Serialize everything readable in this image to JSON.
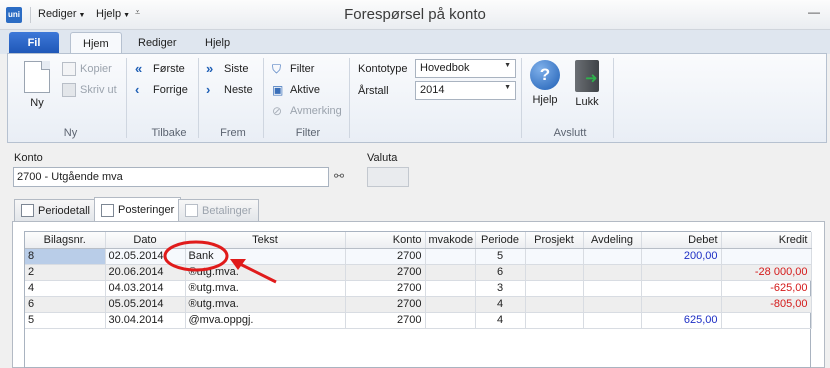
{
  "titlebar": {
    "app_icon_text": "uni",
    "menu_rediger": "Rediger",
    "menu_hjelp": "Hjelp",
    "title": "Forespørsel på konto"
  },
  "ribbon_tabs": {
    "file": "Fil",
    "tabs": [
      "Hjem",
      "Rediger",
      "Hjelp"
    ]
  },
  "ribbon": {
    "ny": {
      "new_label": "Ny",
      "kopier": "Kopier",
      "skriv_ut": "Skriv ut",
      "group": "Ny"
    },
    "tilbake": {
      "forste": "Første",
      "forrige": "Forrige",
      "group": "Tilbake"
    },
    "frem": {
      "siste": "Siste",
      "neste": "Neste",
      "group": "Frem"
    },
    "filter": {
      "filter": "Filter",
      "aktive": "Aktive",
      "avmerking": "Avmerking",
      "group": "Filter"
    },
    "kontotype": {
      "label": "Kontotype",
      "value": "Hovedbok"
    },
    "arstall": {
      "label": "Årstall",
      "value": "2014"
    },
    "avslutt": {
      "hjelp": "Hjelp",
      "lukk": "Lukk",
      "group": "Avslutt"
    }
  },
  "form": {
    "konto_label": "Konto",
    "konto_value": "2700 - Utgående mva",
    "valuta_label": "Valuta"
  },
  "tabs": [
    "Periodetall",
    "Posteringer",
    "Betalinger"
  ],
  "grid": {
    "columns": [
      "Bilagsnr.",
      "Dato",
      "Tekst",
      "Konto",
      "mvakode",
      "Periode",
      "Prosjekt",
      "Avdeling",
      "Debet",
      "Kredit"
    ],
    "rows": [
      {
        "bilagsnr": "8",
        "dato": "02.05.2014",
        "tekst": "Bank",
        "konto": "2700",
        "mvakode": "",
        "periode": "5",
        "prosjekt": "",
        "avdeling": "",
        "debet": "200,00",
        "kredit": ""
      },
      {
        "bilagsnr": "2",
        "dato": "20.06.2014",
        "tekst": "®utg.mva.",
        "konto": "2700",
        "mvakode": "",
        "periode": "6",
        "prosjekt": "",
        "avdeling": "",
        "debet": "",
        "kredit": "-28 000,00"
      },
      {
        "bilagsnr": "4",
        "dato": "04.03.2014",
        "tekst": "®utg.mva.",
        "konto": "2700",
        "mvakode": "",
        "periode": "3",
        "prosjekt": "",
        "avdeling": "",
        "debet": "",
        "kredit": "-625,00"
      },
      {
        "bilagsnr": "6",
        "dato": "05.05.2014",
        "tekst": "®utg.mva.",
        "konto": "2700",
        "mvakode": "",
        "periode": "4",
        "prosjekt": "",
        "avdeling": "",
        "debet": "",
        "kredit": "-805,00"
      },
      {
        "bilagsnr": "5",
        "dato": "30.04.2014",
        "tekst": "@mva.oppgj.",
        "konto": "2700",
        "mvakode": "",
        "periode": "4",
        "prosjekt": "",
        "avdeling": "",
        "debet": "625,00",
        "kredit": ""
      }
    ]
  },
  "colors": {
    "accent": "#1e56b6",
    "annotation": "#e01b1b",
    "debet": "#1d2ec4",
    "kredit": "#d41a1a"
  }
}
